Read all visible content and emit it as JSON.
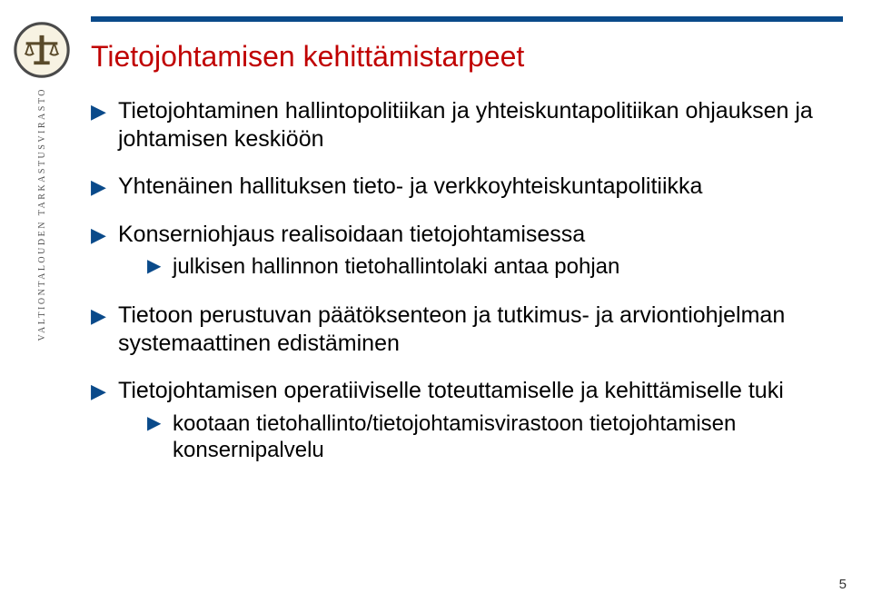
{
  "sidebar": {
    "org_label": "VALTIONTALOUDEN TARKASTUSVIRASTO"
  },
  "title": "Tietojohtamisen kehittämistarpeet",
  "bullets": [
    {
      "text": "Tietojohtaminen hallintopolitiikan ja yhteiskuntapolitiikan ohjauksen ja johtamisen keskiöön",
      "children": []
    },
    {
      "text": "Yhtenäinen hallituksen tieto- ja verkkoyhteiskuntapolitiikka",
      "children": []
    },
    {
      "text": "Konserniohjaus realisoidaan tietojohtamisessa",
      "children": [
        {
          "text": "julkisen hallinnon tietohallintolaki antaa pohjan"
        }
      ]
    },
    {
      "text": "Tietoon perustuvan päätöksenteon ja tutkimus- ja arviontiohjelman systemaattinen edistäminen",
      "children": []
    },
    {
      "text": "Tietojohtamisen operatiiviselle toteuttamiselle ja kehittämiselle tuki",
      "children": [
        {
          "text": "kootaan tietohallinto/tietojohtamisvirastoon tietojohtamisen konsernipalvelu"
        }
      ]
    }
  ],
  "page_number": "5"
}
